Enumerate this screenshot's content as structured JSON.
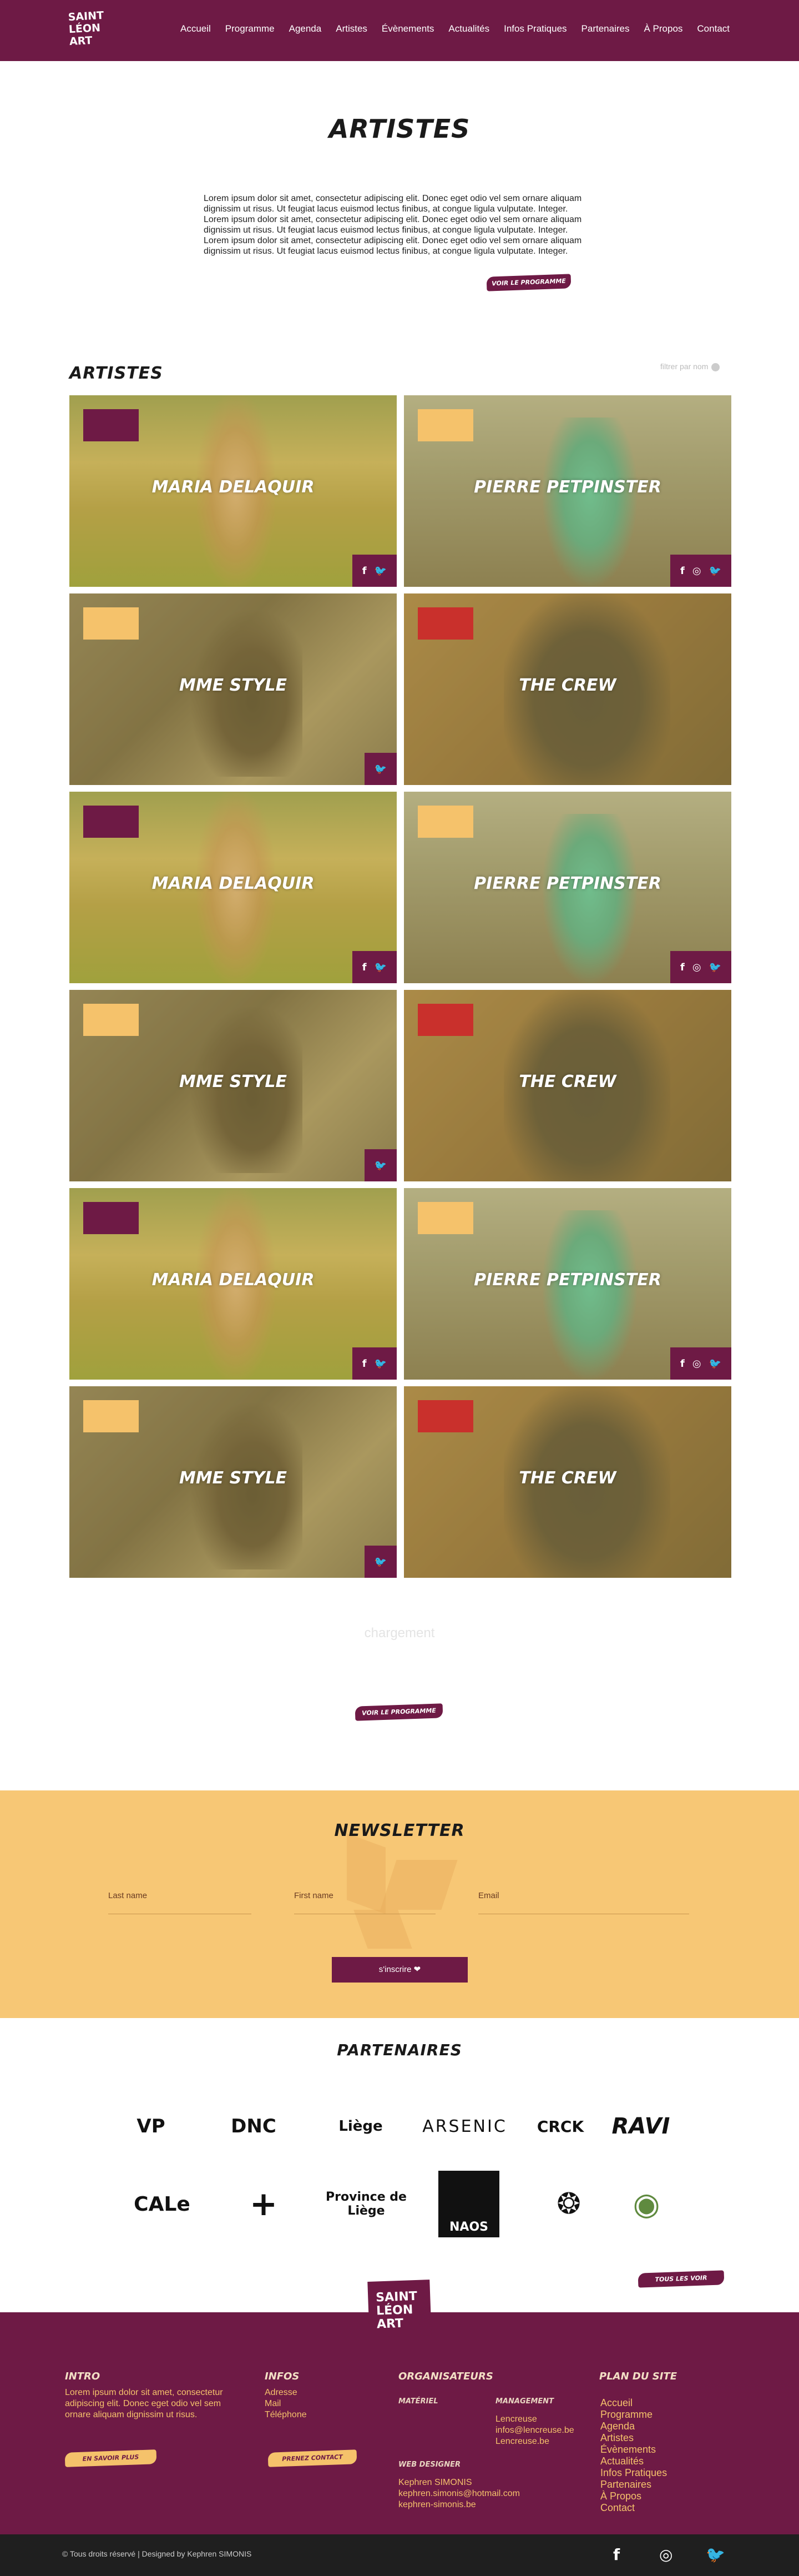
{
  "header": {
    "logo": [
      "SAINT",
      "LÉON",
      "ART"
    ],
    "nav": [
      "Accueil",
      "Programme",
      "Agenda",
      "Artistes",
      "Évènements",
      "Actualités",
      "Infos Pratiques",
      "Partenaires",
      "À Propos",
      "Contact"
    ]
  },
  "page": {
    "title": "ARTISTES",
    "intro": "Lorem ipsum dolor sit amet, consectetur adipiscing elit. Donec eget odio vel sem ornare aliquam dignissim ut risus. Ut feugiat lacus euismod lectus finibus, at congue ligula vulputate. Integer. Lorem ipsum dolor sit amet, consectetur adipiscing elit. Donec eget odio vel sem ornare aliquam dignissim ut risus. Ut feugiat lacus euismod lectus finibus, at congue ligula vulputate. Integer. Lorem ipsum dolor sit amet, consectetur adipiscing elit. Donec eget odio vel sem ornare aliquam dignissim ut risus. Ut feugiat lacus euismod lectus finibus, at congue ligula vulputate. Integer.",
    "program_button": "VOIR LE PROGRAMME"
  },
  "artists_section": {
    "heading": "ARTISTES",
    "filter_label": "filtrer par nom",
    "cards": [
      {
        "name": "MARIA DELAQUIR",
        "swatch": "#6e1a45",
        "photo": "a",
        "social": [
          "f",
          "🐦"
        ]
      },
      {
        "name": "PIERRE PETPINSTER",
        "swatch": "#f5c26b",
        "photo": "b",
        "social": [
          "f",
          "◎",
          "🐦"
        ]
      },
      {
        "name": "MME STYLE",
        "swatch": "#f5c26b",
        "photo": "c",
        "social": [
          "🐦"
        ]
      },
      {
        "name": "THE CREW",
        "swatch": "#c9302c",
        "photo": "d",
        "social": []
      },
      {
        "name": "MARIA DELAQUIR",
        "swatch": "#6e1a45",
        "photo": "a",
        "social": [
          "f",
          "🐦"
        ]
      },
      {
        "name": "PIERRE PETPINSTER",
        "swatch": "#f5c26b",
        "photo": "b",
        "social": [
          "f",
          "◎",
          "🐦"
        ]
      },
      {
        "name": "MME STYLE",
        "swatch": "#f5c26b",
        "photo": "c",
        "social": [
          "🐦"
        ]
      },
      {
        "name": "THE CREW",
        "swatch": "#c9302c",
        "photo": "d",
        "social": []
      },
      {
        "name": "MARIA DELAQUIR",
        "swatch": "#6e1a45",
        "photo": "a",
        "social": [
          "f",
          "🐦"
        ]
      },
      {
        "name": "PIERRE PETPINSTER",
        "swatch": "#f5c26b",
        "photo": "b",
        "social": [
          "f",
          "◎",
          "🐦"
        ]
      },
      {
        "name": "MME STYLE",
        "swatch": "#f5c26b",
        "photo": "c",
        "social": [
          "🐦"
        ]
      },
      {
        "name": "THE CREW",
        "swatch": "#c9302c",
        "photo": "d",
        "social": []
      }
    ],
    "loading": "chargement",
    "program_button": "VOIR LE PROGRAMME"
  },
  "newsletter": {
    "title": "NEWSLETTER",
    "fields": [
      "Last name",
      "First name",
      "Email"
    ],
    "submit": "s'inscrire"
  },
  "partners": {
    "title": "PARTENAIRES",
    "row1": [
      "VP",
      "DNC",
      "Liège",
      "ARSENIC",
      "CRCK",
      "RAVI"
    ],
    "row2": [
      "CALe",
      "+",
      "Province de Liège",
      "NAOS",
      "❂",
      "◉"
    ],
    "see_all": "TOUS LES VOIR"
  },
  "footer": {
    "logo": [
      "SAINT",
      "LÉON",
      "ART"
    ],
    "intro": {
      "heading": "INTRO",
      "text": "Lorem ipsum dolor sit amet, consectetur adipiscing elit. Donec eget odio vel sem ornare aliquam dignissim ut risus.",
      "button": "EN SAVOIR PLUS"
    },
    "infos": {
      "heading": "INFOS",
      "lines": [
        "Adresse",
        "Mail",
        "Téléphone"
      ],
      "button": "PRENEZ CONTACT"
    },
    "organisateurs": {
      "heading": "ORGANISATEURS",
      "materiel_label": "MATÉRIEL",
      "management_label": "MANAGEMENT",
      "management_lines": [
        "Lencreuse",
        "infos@lencreuse.be",
        "Lencreuse.be"
      ],
      "web_label": "WEB DESIGNER",
      "web_lines": [
        "Kephren SIMONIS",
        "kephren.simonis@hotmail.com",
        "kephren-simonis.be"
      ]
    },
    "plan": {
      "heading": "PLAN DU SITE",
      "items": [
        "Accueil",
        "Programme",
        "Agenda",
        "Artistes",
        "Évènements",
        "Actualités",
        "Infos Pratiques",
        "Partenaires",
        "À Propos",
        "Contact"
      ]
    },
    "copyright": "© Tous droits réservé | Designed by Kephren SIMONIS",
    "social": [
      "f",
      "◎",
      "🐦"
    ]
  },
  "colors": {
    "brand": "#6e1a45",
    "accent": "#f5c26b",
    "red": "#c9302c"
  }
}
